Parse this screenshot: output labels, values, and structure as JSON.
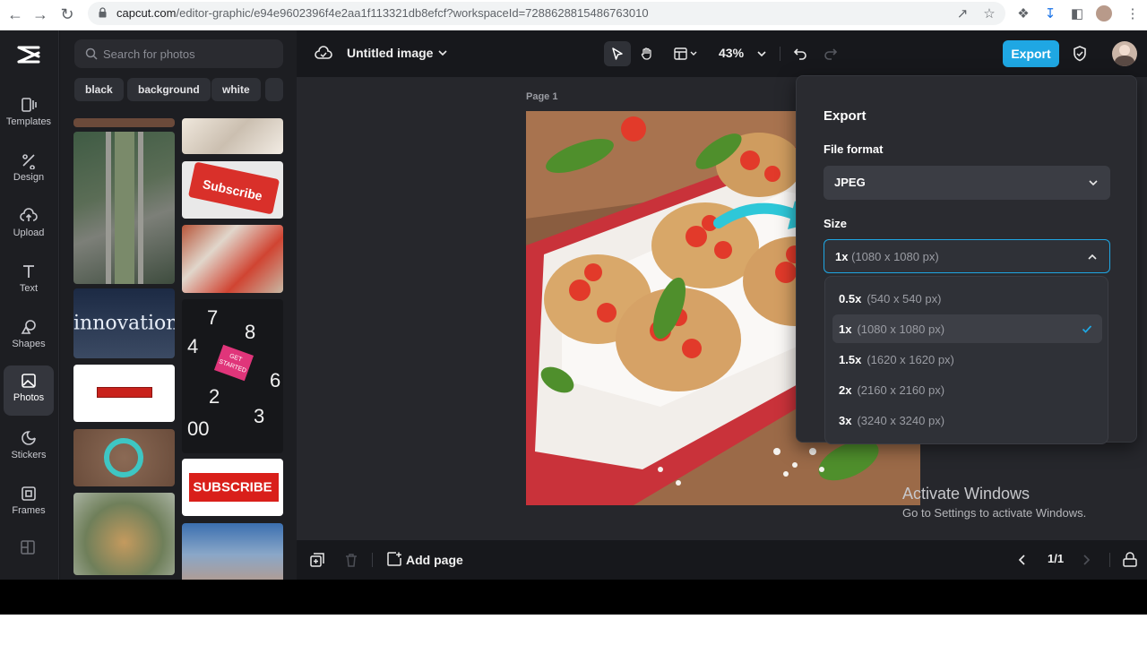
{
  "browser": {
    "url_host": "capcut.com",
    "url_path": "/editor-graphic/e94e9602396f4e2aa1f113321db8efcf?workspaceId=7288628815486763010"
  },
  "sidebar": {
    "items": [
      {
        "label": "Templates",
        "icon": "templates-icon"
      },
      {
        "label": "Design",
        "icon": "design-icon"
      },
      {
        "label": "Upload",
        "icon": "upload-icon"
      },
      {
        "label": "Text",
        "icon": "text-icon"
      },
      {
        "label": "Shapes",
        "icon": "shapes-icon"
      },
      {
        "label": "Photos",
        "icon": "photos-icon"
      },
      {
        "label": "Stickers",
        "icon": "stickers-icon"
      },
      {
        "label": "Frames",
        "icon": "frames-icon"
      }
    ]
  },
  "panel": {
    "search_placeholder": "Search for photos",
    "chips": [
      "black",
      "background",
      "white"
    ],
    "thumb_texts": {
      "subscribe_key": "Subscribe",
      "innovation": "innovation",
      "get_started": "GET STARTED",
      "subscribe_banner": "SUBSCRIBE"
    }
  },
  "topbar": {
    "title": "Untitled image",
    "zoom": "43%",
    "export_label": "Export"
  },
  "canvas": {
    "page_label": "Page 1"
  },
  "bottombar": {
    "add_page": "Add page",
    "pager": "1/1"
  },
  "export_panel": {
    "title": "Export",
    "file_format_label": "File format",
    "file_format_value": "JPEG",
    "size_label": "Size",
    "size_value_key": "1x",
    "size_value_dim": "(1080 x 1080 px)",
    "size_options": [
      {
        "key": "0.5x",
        "dim": "(540 x 540 px)",
        "selected": false
      },
      {
        "key": "1x",
        "dim": "(1080 x 1080 px)",
        "selected": true
      },
      {
        "key": "1.5x",
        "dim": "(1620 x 1620 px)",
        "selected": false
      },
      {
        "key": "2x",
        "dim": "(2160 x 2160 px)",
        "selected": false
      },
      {
        "key": "3x",
        "dim": "(3240 x 3240 px)",
        "selected": false
      }
    ]
  },
  "watermark": {
    "line1": "Activate Windows",
    "line2": "Go to Settings to activate Windows."
  },
  "colors": {
    "accent": "#1fa7e3",
    "app_bg": "#17181c",
    "panel_bg": "#1d1e22",
    "popover_bg": "#2a2b30"
  }
}
